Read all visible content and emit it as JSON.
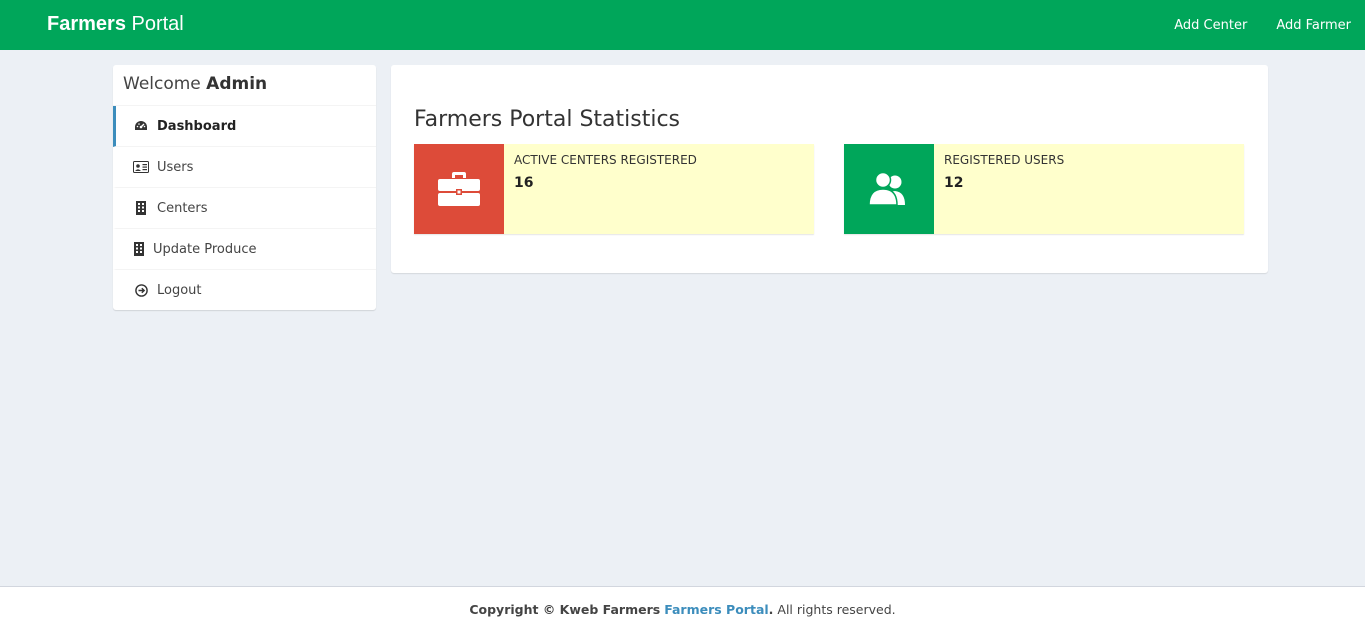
{
  "navbar": {
    "brand_bold": "Farmers",
    "brand_rest": "Portal",
    "links": [
      "Add Center",
      "Add Farmer"
    ],
    "bg_color": "#00a65a"
  },
  "sidebar": {
    "welcome": "Welcome",
    "user": "Admin",
    "items": [
      {
        "label": "Dashboard",
        "icon": "dashboard-icon",
        "active": true
      },
      {
        "label": "Users",
        "icon": "id-card-icon"
      },
      {
        "label": "Centers",
        "icon": "building-icon"
      },
      {
        "label": "Update Produce",
        "icon": "building-icon"
      },
      {
        "label": "Logout",
        "icon": "logout-icon"
      }
    ]
  },
  "main": {
    "title": "Farmers Portal Statistics",
    "stats": [
      {
        "label": "ACTIVE CENTERS REGISTERED",
        "value": "16",
        "icon": "briefcase-icon",
        "color": "#dd4b39"
      },
      {
        "label": "REGISTERED USERS",
        "value": "12",
        "icon": "users-icon",
        "color": "#00a65a"
      }
    ]
  },
  "footer": {
    "prefix": "Copyright © Kweb Farmers",
    "link": "Farmers Portal",
    "suffix": "All rights reserved."
  }
}
